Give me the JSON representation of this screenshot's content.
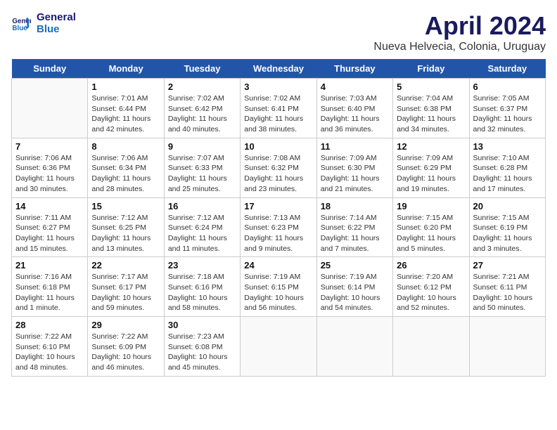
{
  "logo": {
    "line1": "General",
    "line2": "Blue"
  },
  "title": "April 2024",
  "subtitle": "Nueva Helvecia, Colonia, Uruguay",
  "headers": [
    "Sunday",
    "Monday",
    "Tuesday",
    "Wednesday",
    "Thursday",
    "Friday",
    "Saturday"
  ],
  "weeks": [
    [
      {
        "num": "",
        "info": ""
      },
      {
        "num": "1",
        "info": "Sunrise: 7:01 AM\nSunset: 6:44 PM\nDaylight: 11 hours\nand 42 minutes."
      },
      {
        "num": "2",
        "info": "Sunrise: 7:02 AM\nSunset: 6:42 PM\nDaylight: 11 hours\nand 40 minutes."
      },
      {
        "num": "3",
        "info": "Sunrise: 7:02 AM\nSunset: 6:41 PM\nDaylight: 11 hours\nand 38 minutes."
      },
      {
        "num": "4",
        "info": "Sunrise: 7:03 AM\nSunset: 6:40 PM\nDaylight: 11 hours\nand 36 minutes."
      },
      {
        "num": "5",
        "info": "Sunrise: 7:04 AM\nSunset: 6:38 PM\nDaylight: 11 hours\nand 34 minutes."
      },
      {
        "num": "6",
        "info": "Sunrise: 7:05 AM\nSunset: 6:37 PM\nDaylight: 11 hours\nand 32 minutes."
      }
    ],
    [
      {
        "num": "7",
        "info": "Sunrise: 7:06 AM\nSunset: 6:36 PM\nDaylight: 11 hours\nand 30 minutes."
      },
      {
        "num": "8",
        "info": "Sunrise: 7:06 AM\nSunset: 6:34 PM\nDaylight: 11 hours\nand 28 minutes."
      },
      {
        "num": "9",
        "info": "Sunrise: 7:07 AM\nSunset: 6:33 PM\nDaylight: 11 hours\nand 25 minutes."
      },
      {
        "num": "10",
        "info": "Sunrise: 7:08 AM\nSunset: 6:32 PM\nDaylight: 11 hours\nand 23 minutes."
      },
      {
        "num": "11",
        "info": "Sunrise: 7:09 AM\nSunset: 6:30 PM\nDaylight: 11 hours\nand 21 minutes."
      },
      {
        "num": "12",
        "info": "Sunrise: 7:09 AM\nSunset: 6:29 PM\nDaylight: 11 hours\nand 19 minutes."
      },
      {
        "num": "13",
        "info": "Sunrise: 7:10 AM\nSunset: 6:28 PM\nDaylight: 11 hours\nand 17 minutes."
      }
    ],
    [
      {
        "num": "14",
        "info": "Sunrise: 7:11 AM\nSunset: 6:27 PM\nDaylight: 11 hours\nand 15 minutes."
      },
      {
        "num": "15",
        "info": "Sunrise: 7:12 AM\nSunset: 6:25 PM\nDaylight: 11 hours\nand 13 minutes."
      },
      {
        "num": "16",
        "info": "Sunrise: 7:12 AM\nSunset: 6:24 PM\nDaylight: 11 hours\nand 11 minutes."
      },
      {
        "num": "17",
        "info": "Sunrise: 7:13 AM\nSunset: 6:23 PM\nDaylight: 11 hours\nand 9 minutes."
      },
      {
        "num": "18",
        "info": "Sunrise: 7:14 AM\nSunset: 6:22 PM\nDaylight: 11 hours\nand 7 minutes."
      },
      {
        "num": "19",
        "info": "Sunrise: 7:15 AM\nSunset: 6:20 PM\nDaylight: 11 hours\nand 5 minutes."
      },
      {
        "num": "20",
        "info": "Sunrise: 7:15 AM\nSunset: 6:19 PM\nDaylight: 11 hours\nand 3 minutes."
      }
    ],
    [
      {
        "num": "21",
        "info": "Sunrise: 7:16 AM\nSunset: 6:18 PM\nDaylight: 11 hours\nand 1 minute."
      },
      {
        "num": "22",
        "info": "Sunrise: 7:17 AM\nSunset: 6:17 PM\nDaylight: 10 hours\nand 59 minutes."
      },
      {
        "num": "23",
        "info": "Sunrise: 7:18 AM\nSunset: 6:16 PM\nDaylight: 10 hours\nand 58 minutes."
      },
      {
        "num": "24",
        "info": "Sunrise: 7:19 AM\nSunset: 6:15 PM\nDaylight: 10 hours\nand 56 minutes."
      },
      {
        "num": "25",
        "info": "Sunrise: 7:19 AM\nSunset: 6:14 PM\nDaylight: 10 hours\nand 54 minutes."
      },
      {
        "num": "26",
        "info": "Sunrise: 7:20 AM\nSunset: 6:12 PM\nDaylight: 10 hours\nand 52 minutes."
      },
      {
        "num": "27",
        "info": "Sunrise: 7:21 AM\nSunset: 6:11 PM\nDaylight: 10 hours\nand 50 minutes."
      }
    ],
    [
      {
        "num": "28",
        "info": "Sunrise: 7:22 AM\nSunset: 6:10 PM\nDaylight: 10 hours\nand 48 minutes."
      },
      {
        "num": "29",
        "info": "Sunrise: 7:22 AM\nSunset: 6:09 PM\nDaylight: 10 hours\nand 46 minutes."
      },
      {
        "num": "30",
        "info": "Sunrise: 7:23 AM\nSunset: 6:08 PM\nDaylight: 10 hours\nand 45 minutes."
      },
      {
        "num": "",
        "info": ""
      },
      {
        "num": "",
        "info": ""
      },
      {
        "num": "",
        "info": ""
      },
      {
        "num": "",
        "info": ""
      }
    ]
  ]
}
